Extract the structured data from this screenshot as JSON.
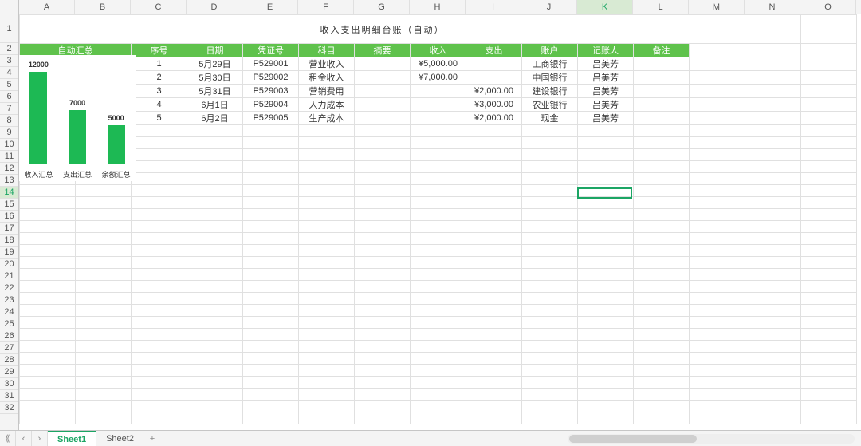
{
  "title": "收入支出明细台账（自动）",
  "cols": [
    "A",
    "B",
    "C",
    "D",
    "E",
    "F",
    "G",
    "H",
    "I",
    "J",
    "K",
    "L",
    "M",
    "N",
    "O"
  ],
  "visible_rows": 32,
  "summary_header": "自动汇总",
  "summary": [
    {
      "label": "收入汇总",
      "amount": "¥12,000.00"
    },
    {
      "label": "支出汇总",
      "amount": "¥7,000.00"
    },
    {
      "label": "余额汇总",
      "amount": "¥5,000.00"
    }
  ],
  "table_headers": [
    "序号",
    "日期",
    "凭证号",
    "科目",
    "摘要",
    "收入",
    "支出",
    "账户",
    "记账人",
    "备注"
  ],
  "rows": [
    {
      "num": "1",
      "date": "5月29日",
      "voucher": "P529001",
      "subject": "营业收入",
      "digest": "",
      "income": "¥5,000.00",
      "expense": "",
      "account": "工商银行",
      "person": "吕美芳",
      "remark": ""
    },
    {
      "num": "2",
      "date": "5月30日",
      "voucher": "P529002",
      "subject": "租金收入",
      "digest": "",
      "income": "¥7,000.00",
      "expense": "",
      "account": "中国银行",
      "person": "吕美芳",
      "remark": ""
    },
    {
      "num": "3",
      "date": "5月31日",
      "voucher": "P529003",
      "subject": "营销费用",
      "digest": "",
      "income": "",
      "expense": "¥2,000.00",
      "account": "建设银行",
      "person": "吕美芳",
      "remark": ""
    },
    {
      "num": "4",
      "date": "6月1日",
      "voucher": "P529004",
      "subject": "人力成本",
      "digest": "",
      "income": "",
      "expense": "¥3,000.00",
      "account": "农业银行",
      "person": "吕美芳",
      "remark": ""
    },
    {
      "num": "5",
      "date": "6月2日",
      "voucher": "P529005",
      "subject": "生产成本",
      "digest": "",
      "income": "",
      "expense": "¥2,000.00",
      "account": "现金",
      "person": "吕美芳",
      "remark": ""
    }
  ],
  "selected_cell": {
    "row": 14,
    "col_letter": "K",
    "col_index": 10
  },
  "chart_data": {
    "type": "bar",
    "categories": [
      "收入汇总",
      "支出汇总",
      "余额汇总"
    ],
    "values": [
      12000,
      7000,
      5000
    ],
    "data_labels": [
      "12000",
      "7000",
      "5000"
    ],
    "title": "",
    "xlabel": "",
    "ylabel": "",
    "ylim": [
      0,
      12000
    ],
    "bar_color": "#1db954"
  },
  "tabs": {
    "nav_first": "⟪",
    "nav_prev": "‹",
    "nav_next": "›",
    "items": [
      "Sheet1",
      "Sheet2"
    ],
    "active": 0,
    "add": "+"
  }
}
